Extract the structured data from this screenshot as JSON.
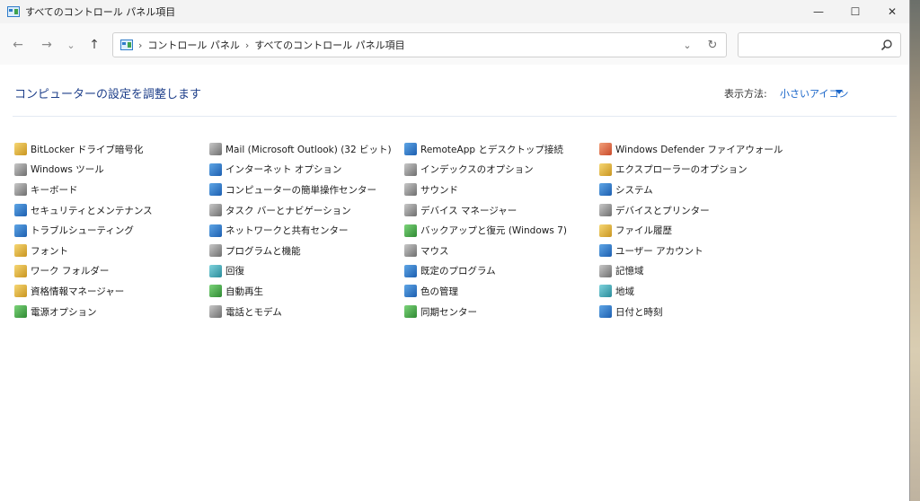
{
  "window": {
    "title": "すべてのコントロール パネル項目",
    "minimize_glyph": "—",
    "maximize_glyph": "☐",
    "close_glyph": "✕"
  },
  "nav": {
    "back_glyph": "←",
    "forward_glyph": "→",
    "recent_glyph": "⌄",
    "up_glyph": "↑",
    "breadcrumb": [
      "コントロール パネル",
      "すべてのコントロール パネル項目"
    ],
    "separator": "›",
    "dropdown_glyph": "⌄",
    "refresh_glyph": "↻",
    "search_placeholder": ""
  },
  "content": {
    "heading": "コンピューターの設定を調整します",
    "view_by_label": "表示方法:",
    "view_by_value": "小さいアイコン"
  },
  "columns": [
    [
      {
        "label": "BitLocker ドライブ暗号化",
        "icon": "bitlocker-icon",
        "color": "i-yellow"
      },
      {
        "label": "Windows ツール",
        "icon": "windows-tools-icon",
        "color": "i-gray"
      },
      {
        "label": "キーボード",
        "icon": "keyboard-icon",
        "color": "i-gray"
      },
      {
        "label": "セキュリティとメンテナンス",
        "icon": "flag-icon",
        "color": "i-blue"
      },
      {
        "label": "トラブルシューティング",
        "icon": "troubleshooting-icon",
        "color": "i-blue"
      },
      {
        "label": "フォント",
        "icon": "font-icon",
        "color": "i-yellow"
      },
      {
        "label": "ワーク フォルダー",
        "icon": "work-folders-icon",
        "color": "i-yellow"
      },
      {
        "label": "資格情報マネージャー",
        "icon": "credential-manager-icon",
        "color": "i-yellow"
      },
      {
        "label": "電源オプション",
        "icon": "power-options-icon",
        "color": "i-green"
      }
    ],
    [
      {
        "label": "Mail (Microsoft Outlook) (32 ビット)",
        "icon": "mail-icon",
        "color": "i-gray"
      },
      {
        "label": "インターネット オプション",
        "icon": "internet-options-icon",
        "color": "i-blue"
      },
      {
        "label": "コンピューターの簡単操作センター",
        "icon": "ease-of-access-icon",
        "color": "i-blue"
      },
      {
        "label": "タスク バーとナビゲーション",
        "icon": "taskbar-icon",
        "color": "i-gray"
      },
      {
        "label": "ネットワークと共有センター",
        "icon": "network-icon",
        "color": "i-blue"
      },
      {
        "label": "プログラムと機能",
        "icon": "programs-icon",
        "color": "i-gray"
      },
      {
        "label": "回復",
        "icon": "recovery-icon",
        "color": "i-teal"
      },
      {
        "label": "自動再生",
        "icon": "autoplay-icon",
        "color": "i-green"
      },
      {
        "label": "電話とモデム",
        "icon": "phone-modem-icon",
        "color": "i-gray"
      }
    ],
    [
      {
        "label": "RemoteApp とデスクトップ接続",
        "icon": "remoteapp-icon",
        "color": "i-blue"
      },
      {
        "label": "インデックスのオプション",
        "icon": "indexing-icon",
        "color": "i-gray"
      },
      {
        "label": "サウンド",
        "icon": "sound-icon",
        "color": "i-gray"
      },
      {
        "label": "デバイス マネージャー",
        "icon": "device-manager-icon",
        "color": "i-gray"
      },
      {
        "label": "バックアップと復元 (Windows 7)",
        "icon": "backup-icon",
        "color": "i-green"
      },
      {
        "label": "マウス",
        "icon": "mouse-icon",
        "color": "i-gray"
      },
      {
        "label": "既定のプログラム",
        "icon": "default-programs-icon",
        "color": "i-blue"
      },
      {
        "label": "色の管理",
        "icon": "color-management-icon",
        "color": "i-blue"
      },
      {
        "label": "同期センター",
        "icon": "sync-center-icon",
        "color": "i-green"
      }
    ],
    [
      {
        "label": "Windows Defender ファイアウォール",
        "icon": "firewall-icon",
        "color": "i-red"
      },
      {
        "label": "エクスプローラーのオプション",
        "icon": "explorer-options-icon",
        "color": "i-yellow"
      },
      {
        "label": "システム",
        "icon": "system-icon",
        "color": "i-blue"
      },
      {
        "label": "デバイスとプリンター",
        "icon": "printer-icon",
        "color": "i-gray"
      },
      {
        "label": "ファイル履歴",
        "icon": "file-history-icon",
        "color": "i-yellow"
      },
      {
        "label": "ユーザー アカウント",
        "icon": "user-accounts-icon",
        "color": "i-blue"
      },
      {
        "label": "記憶域",
        "icon": "storage-icon",
        "color": "i-gray"
      },
      {
        "label": "地域",
        "icon": "region-icon",
        "color": "i-teal"
      },
      {
        "label": "日付と時刻",
        "icon": "date-time-icon",
        "color": "i-blue"
      }
    ]
  ]
}
